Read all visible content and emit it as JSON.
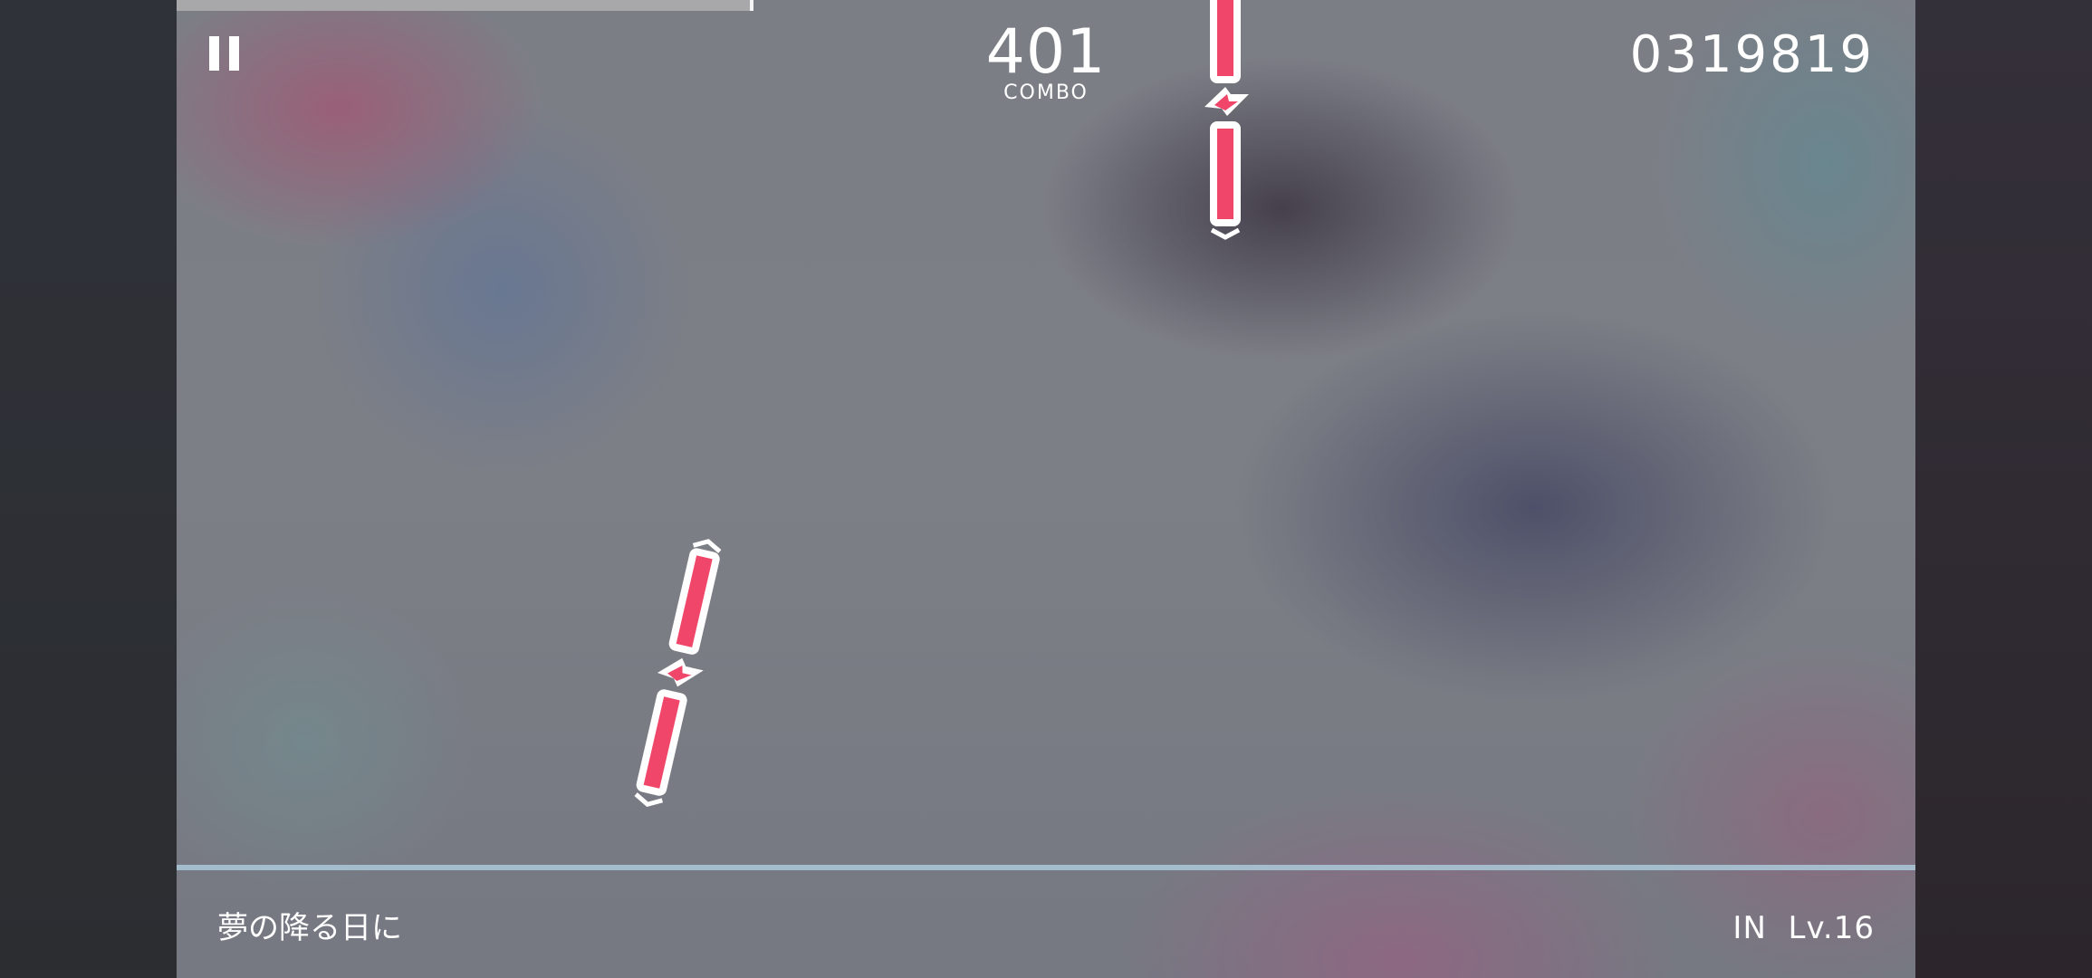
{
  "hud": {
    "progress_fraction": 0.332,
    "combo_value": "401",
    "combo_label": "COMBO",
    "score": "0319819"
  },
  "song": {
    "title": "夢の降る日に",
    "difficulty_level": "IN  Lv.16"
  },
  "icons": {
    "pause": "pause-icon",
    "note_marker": "lightning-icon"
  },
  "colors": {
    "note_fill": "#f0466a",
    "note_outline": "#ffffff",
    "judge_line": "#a9c4d4"
  }
}
